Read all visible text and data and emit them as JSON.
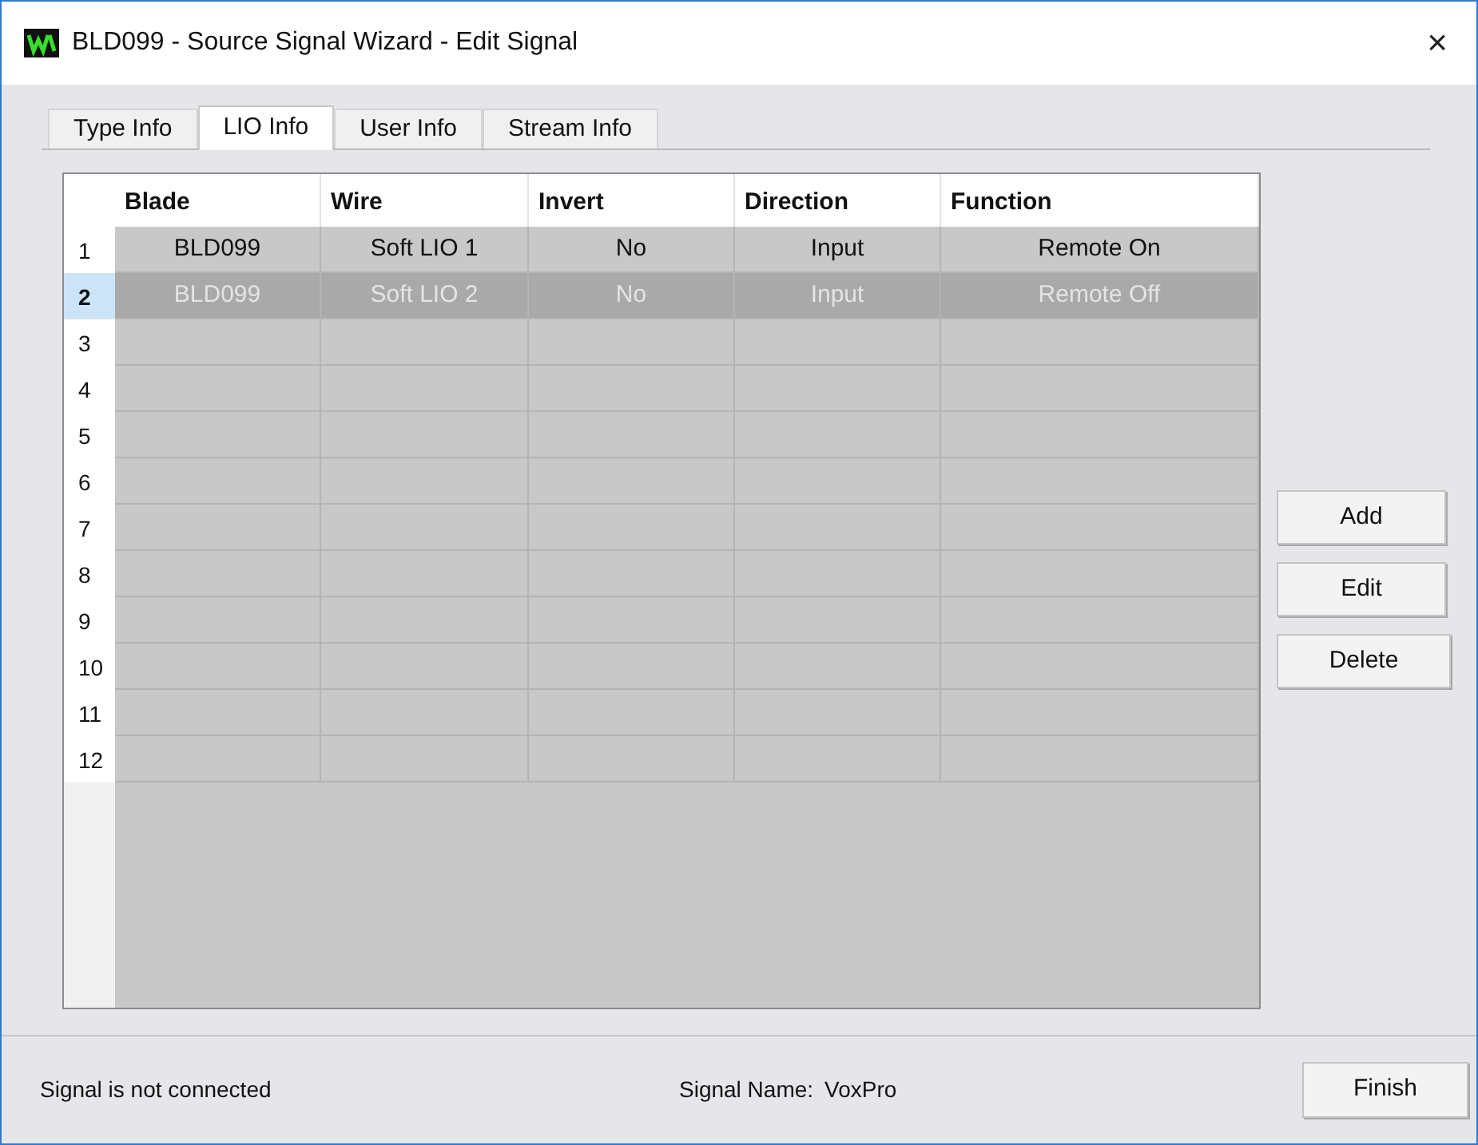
{
  "window": {
    "title": "BLD099 - Source Signal Wizard - Edit Signal",
    "close": "×"
  },
  "tabs": [
    {
      "label": "Type Info",
      "selected": false
    },
    {
      "label": "LIO Info",
      "selected": true
    },
    {
      "label": "User Info",
      "selected": false
    },
    {
      "label": "Stream Info",
      "selected": false
    }
  ],
  "table": {
    "columns": [
      "Blade",
      "Wire",
      "Invert",
      "Direction",
      "Function"
    ],
    "rows": [
      {
        "number": "1",
        "selected": false,
        "cells": [
          "BLD099",
          "Soft LIO 1",
          "No",
          "Input",
          "Remote On"
        ]
      },
      {
        "number": "2",
        "selected": true,
        "cells": [
          "BLD099",
          "Soft LIO 2",
          "No",
          "Input",
          "Remote Off"
        ]
      },
      {
        "number": "3",
        "selected": false
      },
      {
        "number": "4",
        "selected": false
      },
      {
        "number": "5",
        "selected": false
      },
      {
        "number": "6",
        "selected": false
      },
      {
        "number": "7",
        "selected": false
      },
      {
        "number": "8",
        "selected": false
      },
      {
        "number": "9",
        "selected": false
      },
      {
        "number": "10",
        "selected": false
      },
      {
        "number": "11",
        "selected": false
      },
      {
        "number": "12",
        "selected": false
      }
    ]
  },
  "side_buttons": [
    "Add",
    "Edit",
    "Delete"
  ],
  "status_bar": {
    "connection": "Signal is not connected",
    "signal_name_label": "Signal Name:",
    "signal_name": "VoxPro",
    "finish": "Finish"
  }
}
